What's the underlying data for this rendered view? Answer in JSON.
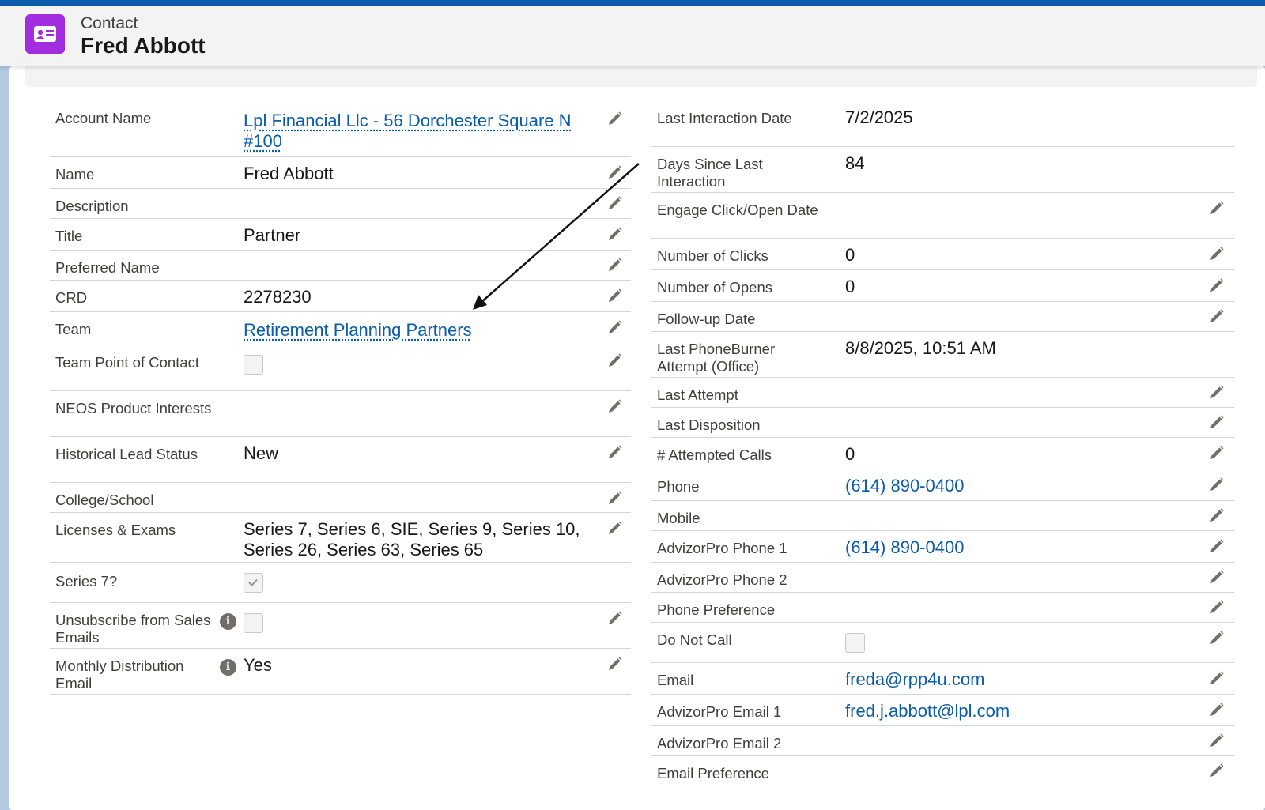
{
  "header": {
    "object_label": "Contact",
    "record_title": "Fred Abbott",
    "icon": "contact-card-icon",
    "accent_color": "#a22ce0"
  },
  "left_fields": [
    {
      "label": "Account Name",
      "value": "Lpl Financial Llc - 56 Dorchester Square N #100",
      "type": "link"
    },
    {
      "label": "Name",
      "value": "Fred Abbott",
      "type": "text"
    },
    {
      "label": "Description",
      "value": "",
      "type": "text"
    },
    {
      "label": "Title",
      "value": "Partner",
      "type": "text"
    },
    {
      "label": "Preferred Name",
      "value": "",
      "type": "text"
    },
    {
      "label": "CRD",
      "value": "2278230",
      "type": "text"
    },
    {
      "label": "Team",
      "value": "Retirement Planning Partners",
      "type": "link"
    },
    {
      "label": "Team Point of Contact",
      "value": "unchecked",
      "type": "checkbox"
    },
    {
      "label": "NEOS Product Interests",
      "value": "",
      "type": "text"
    },
    {
      "label": "Historical Lead Status",
      "value": "New",
      "type": "text"
    },
    {
      "label": "College/School",
      "value": "",
      "type": "text"
    },
    {
      "label": "Licenses & Exams",
      "value": "Series 7, Series 6, SIE, Series 9, Series 10, Series 26, Series 63, Series 65",
      "type": "text"
    },
    {
      "label": "Series 7?",
      "value": "checked",
      "type": "checkbox"
    },
    {
      "label": "Unsubscribe from Sales Emails",
      "value": "unchecked",
      "type": "checkbox"
    },
    {
      "label": "Monthly Distribution Email",
      "value": "Yes",
      "type": "text"
    }
  ],
  "right_fields": [
    {
      "label": "Last Interaction Date",
      "value": "7/2/2025",
      "type": "text"
    },
    {
      "label": "Days Since Last Interaction",
      "value": "84",
      "type": "text"
    },
    {
      "label": "Engage Click/Open Date",
      "value": "",
      "type": "text"
    },
    {
      "label": "Number of Clicks",
      "value": "0",
      "type": "text"
    },
    {
      "label": "Number of Opens",
      "value": "0",
      "type": "text"
    },
    {
      "label": "Follow-up Date",
      "value": "",
      "type": "text"
    },
    {
      "label": "Last PhoneBurner Attempt (Office)",
      "value": "8/8/2025, 10:51 AM",
      "type": "text"
    },
    {
      "label": "Last Attempt",
      "value": "",
      "type": "text"
    },
    {
      "label": "Last Disposition",
      "value": "",
      "type": "text"
    },
    {
      "label": "# Attempted Calls",
      "value": "0",
      "type": "text"
    },
    {
      "label": "Phone",
      "value": "(614) 890-0400",
      "type": "link"
    },
    {
      "label": "Mobile",
      "value": "",
      "type": "text"
    },
    {
      "label": "AdvizorPro Phone 1",
      "value": "(614) 890-0400",
      "type": "link"
    },
    {
      "label": "AdvizorPro Phone 2",
      "value": "",
      "type": "text"
    },
    {
      "label": "Phone Preference",
      "value": "",
      "type": "text"
    },
    {
      "label": "Do Not Call",
      "value": "unchecked",
      "type": "checkbox"
    },
    {
      "label": "Email",
      "value": "freda@rpp4u.com",
      "type": "link"
    },
    {
      "label": "AdvizorPro Email 1",
      "value": "fred.j.abbott@lpl.com",
      "type": "link"
    },
    {
      "label": "AdvizorPro Email 2",
      "value": "",
      "type": "text"
    },
    {
      "label": "Email Preference",
      "value": "",
      "type": "text"
    }
  ],
  "colors": {
    "link": "#0b5cab",
    "border": "#d4d4d4",
    "label": "#3e3e3c"
  }
}
